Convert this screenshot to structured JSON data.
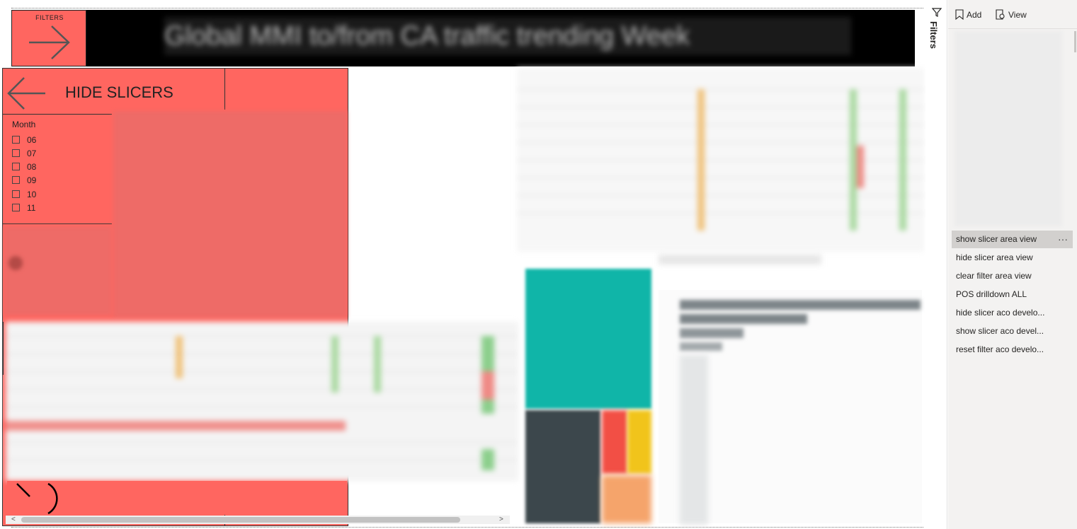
{
  "report": {
    "title": "Global MMI to/from CA traffic trending Week",
    "filters_button_label": "FILTERS"
  },
  "slicer_panel": {
    "hide_label": "HIDE SLICERS",
    "month": {
      "title": "Month",
      "options": [
        "06",
        "07",
        "08",
        "09",
        "10",
        "11"
      ]
    }
  },
  "filters_rail": {
    "label": "Filters"
  },
  "bookmarks": {
    "add_label": "Add",
    "view_label": "View",
    "items": [
      "show slicer area view",
      "hide slicer area view",
      "clear filter area view",
      "POS drilldown ALL",
      "hide slicer aco develo...",
      "show slicer aco devel...",
      "reset filter aco develo..."
    ],
    "selected_index": 0
  },
  "colors": {
    "slicer_bg": "#ff6660",
    "banner_bg": "#000000",
    "teal": "#10b5a8",
    "dark": "#3c474c",
    "red": "#f24f45",
    "yellow": "#f1c41b",
    "pane_bg": "#f3f2f1"
  },
  "icons": {
    "filters_button": "arrow-right-icon",
    "hide_slicers": "arrow-left-icon",
    "add": "bookmark-add-icon",
    "view": "view-icon",
    "filters_rail": "funnel-icon",
    "more": "more-options-icon"
  }
}
